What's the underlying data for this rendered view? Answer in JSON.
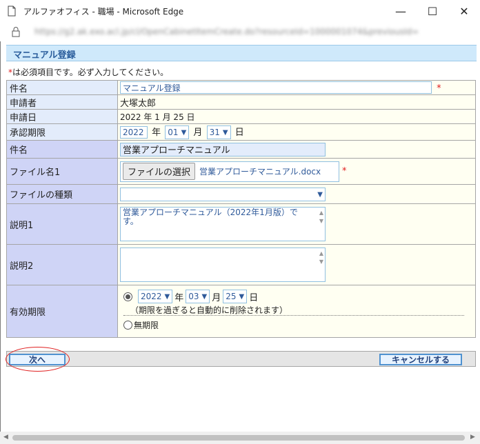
{
  "window": {
    "title": "アルファオフィス - 職場 - Microsoft Edge",
    "url": "https://g2.ak.exo.acl.jp/cl/OpenCabinetItemCreate.do?resourceId=1000001074&previousId=",
    "controls": {
      "minimize": "—",
      "maximize": "☐",
      "close": "✕"
    }
  },
  "page": {
    "header": "マニュアル登録",
    "required_note_mark": "*",
    "required_note_text": "は必須項目です。必ず入力してください。"
  },
  "form": {
    "subject_label": "件名",
    "subject_value": "マニュアル登録",
    "required_mark": "*",
    "applicant_label": "申請者",
    "applicant_value": "大塚太郎",
    "apply_date_label": "申請日",
    "apply_date_value": "2022 年 1 月 25 日",
    "approval_label": "承認期限",
    "approval_year": "2022",
    "year_unit": "年",
    "approval_month": "01",
    "month_unit": "月",
    "approval_day": "31",
    "day_unit": "日",
    "item_name_label": "件名",
    "item_name_value": "営業アプローチマニュアル",
    "file_label": "ファイル名1",
    "file_button": "ファイルの選択",
    "file_name": "営業アプローチマニュアル.docx",
    "file_type_label": "ファイルの種類",
    "file_type_value": "",
    "desc1_label": "説明1",
    "desc1_value": "営業アプローチマニュアル（2022年1月版）です。",
    "desc2_label": "説明2",
    "desc2_value": "",
    "expiry_label": "有効期限",
    "expiry_year": "2022",
    "expiry_month": "03",
    "expiry_day": "25",
    "expiry_note": "（期限を過ぎると自動的に削除されます）",
    "no_expiry_label": "無期限",
    "expiry_selected": "date"
  },
  "buttons": {
    "next": "次へ",
    "cancel": "キャンセルする"
  },
  "colors": {
    "header_bg": "#cfe9fb",
    "label_blue": "#e3ecfb",
    "label_purple": "#cfd4f6",
    "value_bg": "#fffff2",
    "input_text": "#2f5a9a",
    "required": "#e01a1a",
    "highlight_oval": "#e02020"
  }
}
